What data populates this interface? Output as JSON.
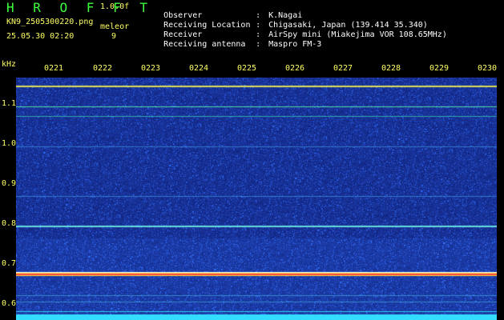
{
  "header": {
    "app_title": "H R O F F T",
    "version": "1.0.0f",
    "filename": "KN9_2505300220.png",
    "mode": "meleor",
    "timestamp": "25.05.30 02:20",
    "mode_value": "9"
  },
  "info": [
    {
      "label": "Observer",
      "value": "K.Nagai"
    },
    {
      "label": "Receiving Location",
      "value": "Chigasaki, Japan (139.414 35.340)"
    },
    {
      "label": "Receiver",
      "value": "AirSpy mini (Miakejima VOR 108.65MHz)"
    },
    {
      "label": "Receiving antenna",
      "value": "Maspro FM-3"
    }
  ],
  "axes": {
    "y_unit": "kHz",
    "y_ticks": [
      "1.1",
      "1.0",
      "0.9",
      "0.8",
      "0.7",
      "0.6"
    ],
    "x_ticks": [
      "0221",
      "0222",
      "0223",
      "0224",
      "0225",
      "0226",
      "0227",
      "0228",
      "0229",
      "0230"
    ]
  },
  "colors": {
    "background": "#0a1a7a",
    "label": "#ffff66",
    "title": "#3cff3c"
  }
}
